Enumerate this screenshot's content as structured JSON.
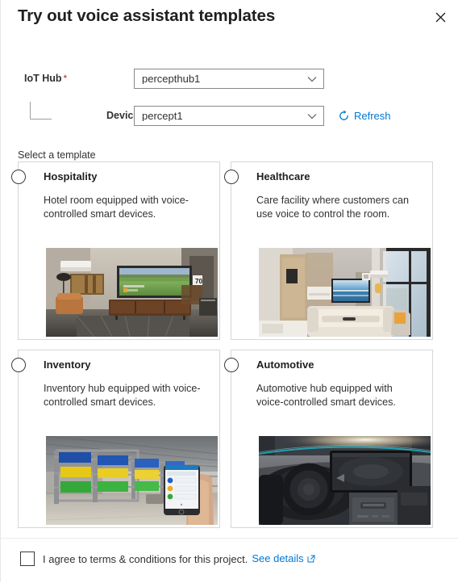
{
  "header": {
    "title": "Try out voice assistant templates",
    "close_icon": "close-icon"
  },
  "form": {
    "iot_hub": {
      "label": "IoT Hub",
      "required_marker": "*",
      "value": "percepthub1",
      "caret_icon": "chevron-down-icon"
    },
    "device": {
      "label": "Device",
      "required_marker": "*",
      "value": "percept1",
      "caret_icon": "chevron-down-icon"
    },
    "refresh": {
      "label": "Refresh",
      "icon": "refresh-circular-arrow-icon"
    }
  },
  "templates": {
    "section_label": "Select a template",
    "items": [
      {
        "name": "Hospitality",
        "description": "Hotel room equipped with voice-controlled smart devices.",
        "radio_icon": "radio-unselected-icon",
        "image_alt": "hotel-room-photo",
        "selected": false
      },
      {
        "name": "Healthcare",
        "description": "Care facility where customers can use voice to control the room.",
        "radio_icon": "radio-unselected-icon",
        "image_alt": "care-facility-room-photo",
        "selected": false
      },
      {
        "name": "Inventory",
        "description": "Inventory hub equipped with voice-controlled smart devices.",
        "radio_icon": "radio-unselected-icon",
        "image_alt": "warehouse-inventory-photo",
        "selected": false
      },
      {
        "name": "Automotive",
        "description": "Automotive hub equipped with voice-controlled smart devices.",
        "radio_icon": "radio-unselected-icon",
        "image_alt": "car-dashboard-photo",
        "selected": false
      }
    ]
  },
  "footer": {
    "agree_text": "I agree to terms & conditions for this project.",
    "see_details_label": "See details",
    "external_link_icon": "external-link-icon",
    "checkbox_icon": "checkbox-unchecked-icon",
    "checked": false
  },
  "colors": {
    "accent": "#0078d4",
    "required": "#a4262c",
    "text": "#323130",
    "border": "#8a8886",
    "card_border": "#d6d6d6"
  }
}
